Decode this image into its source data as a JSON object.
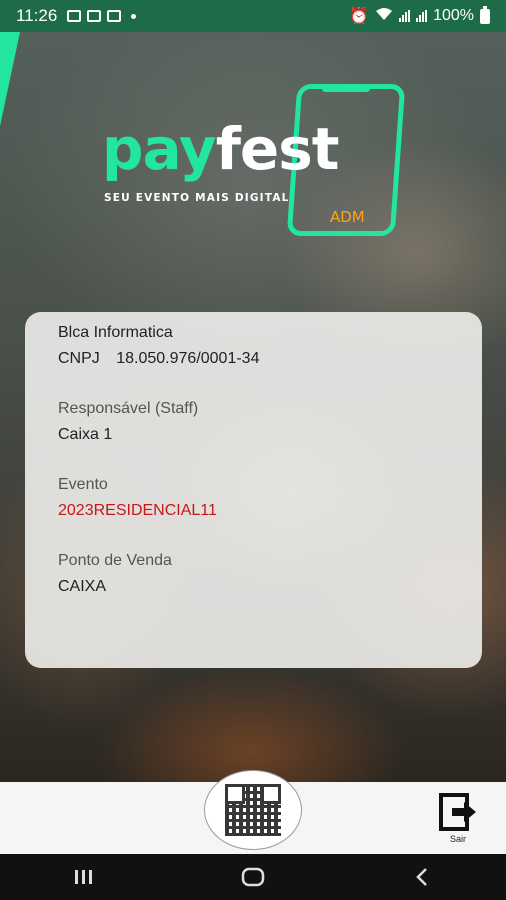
{
  "status_bar": {
    "time": "11:26",
    "battery_percent": "100%"
  },
  "logo": {
    "brand_part1": "pay",
    "brand_part2": "fest",
    "tagline": "SEU EVENTO MAIS DIGITAL",
    "badge": "ADM"
  },
  "card": {
    "company_name": "Blca Informatica",
    "cnpj_label": "CNPJ",
    "cnpj_value": "18.050.976/0001-34",
    "responsavel_label": "Responsável (Staff)",
    "responsavel_value": "Caixa 1",
    "evento_label": "Evento",
    "evento_value": "2023RESIDENCIAL11",
    "ponto_label": "Ponto de Venda",
    "ponto_value": "CAIXA"
  },
  "actions": {
    "exit_label": "Sair"
  },
  "colors": {
    "brand_green": "#22e5a0",
    "status_bar": "#1e6b47",
    "adm_orange": "#ffa31a",
    "evento_red": "#c8161d"
  },
  "icons": [
    "image-icon",
    "teams-icon",
    "outlook-icon",
    "alarm-icon",
    "wifi-icon",
    "signal-icon",
    "battery-icon",
    "qr-code-icon",
    "exit-icon",
    "recents-icon",
    "home-icon",
    "back-icon"
  ]
}
